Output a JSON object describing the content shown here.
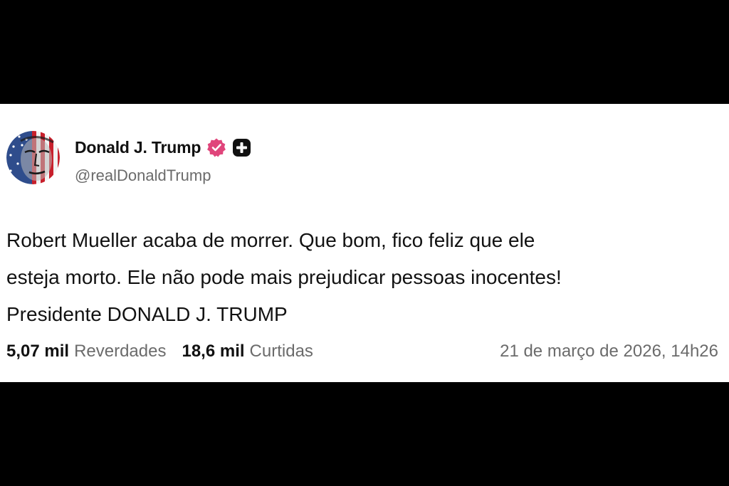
{
  "author": {
    "display_name": "Donald J. Trump",
    "handle": "@realDonaldTrump",
    "avatar_icon": "flag-face-avatar",
    "verified_badge_icon": "verified-badge-icon",
    "verified_color": "#e0457b",
    "plus_badge_icon": "plus-badge-icon"
  },
  "post": {
    "lines": [
      "Robert Mueller acaba de morrer. Que bom, fico feliz que ele",
      "esteja morto. Ele não pode mais prejudicar pessoas inocentes!",
      "Presidente DONALD J. TRUMP"
    ]
  },
  "stats": {
    "reposts_count": "5,07 mil",
    "reposts_label": "Reverdades",
    "likes_count": "18,6 mil",
    "likes_label": "Curtidas",
    "timestamp": "21 de março de 2026, 14h26"
  },
  "colors": {
    "page_background": "#000000",
    "card_background": "#ffffff",
    "muted_text": "#6b6b6b"
  }
}
